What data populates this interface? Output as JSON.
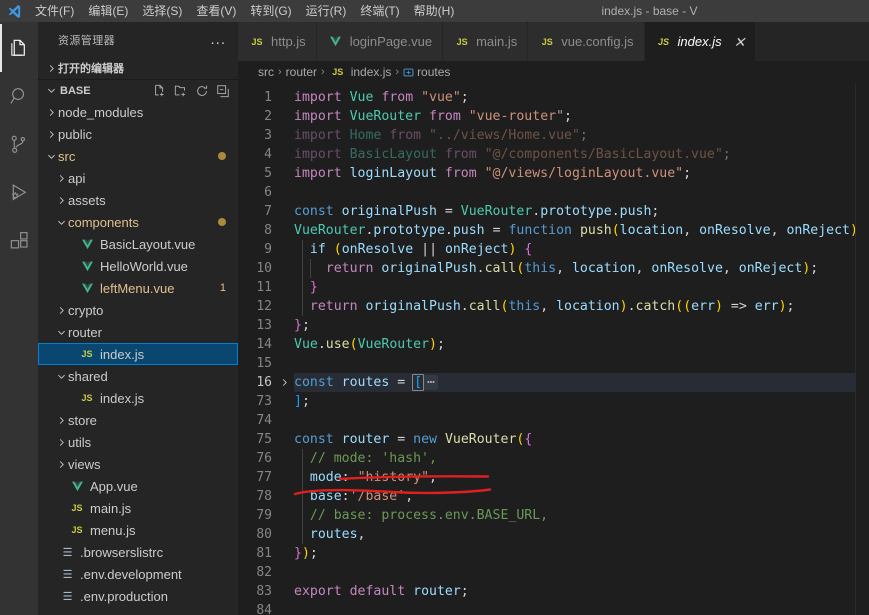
{
  "window": {
    "title": "index.js - base - V",
    "logo_icon": "vscode-logo-icon"
  },
  "menubar": {
    "items": [
      {
        "label": "文件(F)",
        "name": "menu-file"
      },
      {
        "label": "编辑(E)",
        "name": "menu-edit"
      },
      {
        "label": "选择(S)",
        "name": "menu-selection"
      },
      {
        "label": "查看(V)",
        "name": "menu-view"
      },
      {
        "label": "转到(G)",
        "name": "menu-go"
      },
      {
        "label": "运行(R)",
        "name": "menu-run"
      },
      {
        "label": "终端(T)",
        "name": "menu-terminal"
      },
      {
        "label": "帮助(H)",
        "name": "menu-help"
      }
    ]
  },
  "activitybar": {
    "items": [
      {
        "icon": "files-explorer-icon",
        "active": true
      },
      {
        "icon": "search-icon",
        "active": false
      },
      {
        "icon": "source-control-icon",
        "active": false
      },
      {
        "icon": "run-and-debug-icon",
        "active": false
      },
      {
        "icon": "extensions-icon",
        "active": false
      }
    ]
  },
  "sidebar": {
    "header_title": "资源管理器",
    "more_actions_label": "...",
    "open_editors_label": "打开的编辑器",
    "root_label": "BASE",
    "root_actions": [
      "new-file-icon",
      "new-folder-icon",
      "refresh-icon",
      "collapse-all-icon"
    ],
    "tree": [
      {
        "label": "node_modules",
        "depth": 1,
        "kind": "folder",
        "expanded": false,
        "modified": false,
        "badge": "",
        "selected": false
      },
      {
        "label": "public",
        "depth": 1,
        "kind": "folder",
        "expanded": false,
        "modified": false,
        "badge": "",
        "selected": false
      },
      {
        "label": "src",
        "depth": 1,
        "kind": "folder",
        "expanded": true,
        "modified": true,
        "badge": "dot",
        "selected": false
      },
      {
        "label": "api",
        "depth": 2,
        "kind": "folder",
        "expanded": false,
        "modified": false,
        "badge": "",
        "selected": false
      },
      {
        "label": "assets",
        "depth": 2,
        "kind": "folder",
        "expanded": false,
        "modified": false,
        "badge": "",
        "selected": false
      },
      {
        "label": "components",
        "depth": 2,
        "kind": "folder",
        "expanded": true,
        "modified": true,
        "badge": "dot",
        "selected": false
      },
      {
        "label": "BasicLayout.vue",
        "depth": 3,
        "kind": "vue",
        "expanded": null,
        "modified": false,
        "badge": "",
        "selected": false
      },
      {
        "label": "HelloWorld.vue",
        "depth": 3,
        "kind": "vue",
        "expanded": null,
        "modified": false,
        "badge": "",
        "selected": false
      },
      {
        "label": "leftMenu.vue",
        "depth": 3,
        "kind": "vue",
        "expanded": null,
        "modified": true,
        "badge": "1",
        "selected": false
      },
      {
        "label": "crypto",
        "depth": 2,
        "kind": "folder",
        "expanded": false,
        "modified": false,
        "badge": "",
        "selected": false
      },
      {
        "label": "router",
        "depth": 2,
        "kind": "folder",
        "expanded": true,
        "modified": false,
        "badge": "",
        "selected": false
      },
      {
        "label": "index.js",
        "depth": 3,
        "kind": "js",
        "expanded": null,
        "modified": false,
        "badge": "",
        "selected": true
      },
      {
        "label": "shared",
        "depth": 2,
        "kind": "folder",
        "expanded": true,
        "modified": false,
        "badge": "",
        "selected": false
      },
      {
        "label": "index.js",
        "depth": 3,
        "kind": "js",
        "expanded": null,
        "modified": false,
        "badge": "",
        "selected": false
      },
      {
        "label": "store",
        "depth": 2,
        "kind": "folder",
        "expanded": false,
        "modified": false,
        "badge": "",
        "selected": false
      },
      {
        "label": "utils",
        "depth": 2,
        "kind": "folder",
        "expanded": false,
        "modified": false,
        "badge": "",
        "selected": false
      },
      {
        "label": "views",
        "depth": 2,
        "kind": "folder",
        "expanded": false,
        "modified": false,
        "badge": "",
        "selected": false
      },
      {
        "label": "App.vue",
        "depth": 2,
        "kind": "vue",
        "expanded": null,
        "modified": false,
        "badge": "",
        "selected": false
      },
      {
        "label": "main.js",
        "depth": 2,
        "kind": "js",
        "expanded": null,
        "modified": false,
        "badge": "",
        "selected": false
      },
      {
        "label": "menu.js",
        "depth": 2,
        "kind": "js",
        "expanded": null,
        "modified": false,
        "badge": "",
        "selected": false
      },
      {
        "label": ".browserslistrc",
        "depth": 1,
        "kind": "config",
        "expanded": null,
        "modified": false,
        "badge": "",
        "selected": false
      },
      {
        "label": ".env.development",
        "depth": 1,
        "kind": "config",
        "expanded": null,
        "modified": false,
        "badge": "",
        "selected": false
      },
      {
        "label": ".env.production",
        "depth": 1,
        "kind": "config",
        "expanded": null,
        "modified": false,
        "badge": "",
        "selected": false
      }
    ]
  },
  "editor": {
    "tabs": [
      {
        "label": "http.js",
        "kind": "js",
        "active": false,
        "closable": false
      },
      {
        "label": "loginPage.vue",
        "kind": "vue",
        "active": false,
        "closable": false
      },
      {
        "label": "main.js",
        "kind": "js",
        "active": false,
        "closable": false
      },
      {
        "label": "vue.config.js",
        "kind": "js",
        "active": false,
        "closable": false
      },
      {
        "label": "index.js",
        "kind": "js",
        "active": true,
        "closable": true
      }
    ],
    "tab_close_glyph": "✕",
    "breadcrumbs": [
      {
        "label": "src",
        "icon": ""
      },
      {
        "label": "router",
        "icon": ""
      },
      {
        "label": "index.js",
        "icon": "js-file-icon"
      },
      {
        "label": "routes",
        "icon": "symbol-variable-icon"
      }
    ],
    "breadcrumb_separator": "›",
    "line_numbers": [
      1,
      2,
      3,
      4,
      5,
      6,
      7,
      8,
      9,
      10,
      11,
      12,
      13,
      14,
      15,
      16,
      73,
      74,
      75,
      76,
      77,
      78,
      79,
      80,
      81,
      82,
      83,
      84
    ],
    "current_line_number": 16,
    "fold_chevron_line": 16,
    "fold_placeholder": "⋯",
    "code_lines": [
      "import Vue from \"vue\";",
      "import VueRouter from \"vue-router\";",
      "import Home from \"../views/Home.vue\";",
      "import BasicLayout from \"@/components/BasicLayout.vue\";",
      "import loginLayout from \"@/views/loginLayout.vue\";",
      "",
      "const originalPush = VueRouter.prototype.push;",
      "VueRouter.prototype.push = function push(location, onResolve, onReject) {",
      "  if (onResolve || onReject) {",
      "    return originalPush.call(this, location, onResolve, onReject);",
      "  }",
      "  return originalPush.call(this, location).catch((err) => err);",
      "};",
      "Vue.use(VueRouter);",
      "",
      "const routes = [⋯",
      "];",
      "",
      "const router = new VueRouter({",
      "  // mode: 'hash',",
      "  mode: \"history\",",
      "  base:'/base',",
      "  // base: process.env.BASE_URL,",
      "  routes,",
      "});",
      "",
      "export default router;",
      ""
    ],
    "annotation": {
      "type": "red-ink-underline",
      "color": "#e02020",
      "target_text": "base:'/base',",
      "strokes": 2
    }
  },
  "colors": {
    "titlebar_bg": "#3c3c3c",
    "activitybar_bg": "#333333",
    "sidebar_bg": "#252526",
    "editor_bg": "#1e1e1e",
    "tab_active_bg": "#1e1e1e",
    "tab_inactive_bg": "#2d2d2d",
    "selection_blue": "#094771",
    "selection_border": "#007fd4",
    "folded_line_bg": "#282d35",
    "modified_yellow": "#e2c08d",
    "annotation_red": "#e02020"
  }
}
